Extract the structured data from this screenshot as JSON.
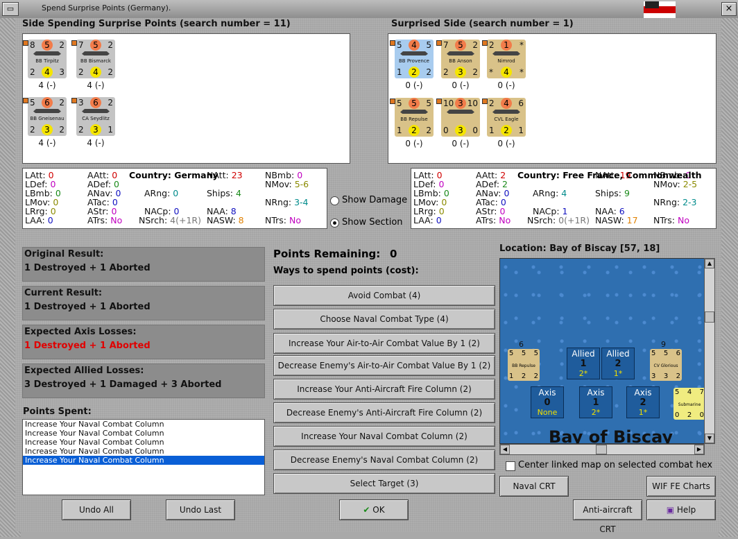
{
  "window": {
    "title": "Spend Surprise Points (Germany)."
  },
  "spending": {
    "header": "Side Spending Surprise Points (search number = 11)",
    "units": [
      {
        "tl": "8",
        "top": "5",
        "tr": "2",
        "name": "BB Tirpitz",
        "bl": "2",
        "bot": "4",
        "br": "3",
        "sub": "4 (-)",
        "color": "grey"
      },
      {
        "tl": "7",
        "top": "5",
        "tr": "2",
        "name": "BB Bismarck",
        "bl": "2",
        "bot": "4",
        "br": "2",
        "sub": "4 (-)",
        "color": "grey"
      },
      {
        "tl": "5",
        "top": "6",
        "tr": "2",
        "name": "BB Gneisenau",
        "bl": "2",
        "bot": "3",
        "br": "2",
        "sub": "4 (-)",
        "color": "grey"
      },
      {
        "tl": "3",
        "top": "6",
        "tr": "2",
        "name": "CA Seydlitz",
        "bl": "2",
        "bot": "3",
        "br": "1",
        "sub": "4 (-)",
        "color": "grey"
      }
    ]
  },
  "surprised": {
    "header": "Surprised Side (search number = 1)",
    "units": [
      {
        "tl": "5",
        "top": "4",
        "tr": "5",
        "name": "BB Provence",
        "bl": "1",
        "bot": "2",
        "br": "2",
        "sub": "0 (-)",
        "color": "blue"
      },
      {
        "tl": "7",
        "top": "5",
        "tr": "2",
        "name": "BB Anson",
        "bl": "2",
        "bot": "3",
        "br": "2",
        "sub": "0 (-)",
        "color": "tan"
      },
      {
        "tl": "2",
        "top": "1",
        "tr": "*",
        "name": "Nimrod",
        "bl": "*",
        "bot": "4",
        "br": "*",
        "sub": "0 (-)",
        "color": "tan"
      },
      {
        "tl": "5",
        "top": "5",
        "tr": "5",
        "name": "BB Repulse",
        "bl": "1",
        "bot": "2",
        "br": "2",
        "sub": "0 (-)",
        "color": "tan"
      },
      {
        "tl": "10",
        "top": "3",
        "tr": "10",
        "name": "",
        "bl": "0",
        "bot": "3",
        "br": "0",
        "sub": "0 (-)",
        "color": "tan"
      },
      {
        "tl": "2",
        "top": "4",
        "tr": "6",
        "name": "CVL Eagle",
        "bl": "1",
        "bot": "2",
        "br": "1",
        "sub": "0 (-)",
        "color": "tan"
      }
    ]
  },
  "stats_left": {
    "country_label": "Country:",
    "country": "Germany",
    "LAtt": "0",
    "LDef": "0",
    "LBmb": "0",
    "LMov": "0",
    "LRrg": "0",
    "LAA": "0",
    "AAtt": "0",
    "ADef": "0",
    "ANav": "0",
    "ATac": "0",
    "AStr": "0",
    "ATrs": "No",
    "ARng": "0",
    "NACp": "0",
    "NSrch": "4(+1R)",
    "NAtt": "23",
    "Ships": "4",
    "NAA": "8",
    "NASW": "8",
    "NBmb": "0",
    "NMov": "5-6",
    "NRng": "3-4",
    "NTrs": "No"
  },
  "stats_right": {
    "country_label": "Country:",
    "country": "Free France, Commonwealth",
    "LAtt": "0",
    "LDef": "0",
    "LBmb": "0",
    "LMov": "0",
    "LRrg": "0",
    "LAA": "0",
    "AAtt": "2",
    "ADef": "2",
    "ANav": "0",
    "ATac": "0",
    "AStr": "0",
    "ATrs": "No",
    "ARng": "4",
    "NACp": "1",
    "NSrch": "0(+1R)",
    "NAtt": "19",
    "Ships": "9",
    "NAA": "6",
    "NASW": "17",
    "NBmb": "0",
    "NMov": "2-5",
    "NRng": "2-3",
    "NTrs": "No"
  },
  "labels": {
    "LAtt": "LAtt:",
    "LDef": "LDef:",
    "LBmb": "LBmb:",
    "LMov": "LMov:",
    "LRrg": "LRrg:",
    "LAA": "LAA:",
    "AAtt": "AAtt:",
    "ADef": "ADef:",
    "ANav": "ANav:",
    "ATac": "ATac:",
    "AStr": "AStr:",
    "ATrs": "ATrs:",
    "ARng": "ARng:",
    "NACp": "NACp:",
    "NSrch": "NSrch:",
    "NAtt": "NAtt:",
    "Ships": "Ships:",
    "NAA": "NAA:",
    "NASW": "NASW:",
    "NBmb": "NBmb:",
    "NMov": "NMov:",
    "NRng": "NRng:",
    "NTrs": "NTrs:"
  },
  "view": {
    "show_damage": "Show Damage",
    "show_section": "Show Section",
    "selected": "show_section"
  },
  "results": {
    "original_title": "Original Result:",
    "original": "1 Destroyed + 1 Aborted",
    "current_title": "Current Result:",
    "current": "1 Destroyed + 1 Aborted",
    "axis_title": "Expected Axis Losses:",
    "axis": "1 Destroyed + 1 Aborted",
    "allied_title": "Expected Allied Losses:",
    "allied": "3 Destroyed + 1 Damaged + 3 Aborted"
  },
  "points_spent": {
    "title": "Points Spent:",
    "items": [
      "Increase Your Naval Combat Column",
      "Increase Your Naval Combat Column",
      "Increase Your Naval Combat Column",
      "Increase Your Naval Combat Column",
      "Increase Your Naval Combat Column"
    ],
    "selected_index": 4
  },
  "spend": {
    "remaining_label": "Points Remaining:",
    "remaining": "0",
    "ways_label": "Ways to spend points (cost):",
    "options": [
      "Avoid Combat (4)",
      "Choose Naval Combat Type (4)",
      "Increase Your Air-to-Air Combat Value By 1 (2)",
      "Decrease Enemy's Air-to-Air Combat Value By 1 (2)",
      "Increase Your Anti-Aircraft Fire Column (2)",
      "Decrease Enemy's Anti-Aircraft Fire Column (2)",
      "Increase Your Naval Combat Column (2)",
      "Decrease Enemy's Naval Combat Column (2)",
      "Select Target (3)"
    ]
  },
  "map": {
    "location": "Location: Bay of Biscay [57, 18]",
    "sea_label": "Bay of Biscay",
    "allied": [
      {
        "label": "Allied",
        "num": "1",
        "sub": "2*"
      },
      {
        "label": "Allied",
        "num": "2",
        "sub": "1*"
      }
    ],
    "axis": [
      {
        "label": "Axis",
        "num": "0",
        "sub": "None"
      },
      {
        "label": "Axis",
        "num": "1",
        "sub": "2*"
      },
      {
        "label": "Axis",
        "num": "2",
        "sub": "1*"
      }
    ],
    "stack1": {
      "count": "6",
      "name": "BB Repulse",
      "t1": "5",
      "t2": "5",
      "t3": "5",
      "b1": "1",
      "b2": "2",
      "b3": "2"
    },
    "stack2": {
      "count": "9",
      "name": "CV Glorious",
      "t1": "5",
      "t2": "5",
      "t3": "6",
      "b1": "3",
      "b2": "3",
      "b3": "2"
    },
    "stack3": {
      "count": "",
      "name": "Submarine",
      "t1": "5",
      "t2": "4",
      "t3": "7",
      "b1": "0",
      "b2": "2",
      "b3": "0"
    },
    "center_linked": "Center linked map on selected combat hex",
    "center_checked": false
  },
  "buttons": {
    "undo_all": "Undo All",
    "undo_last": "Undo Last",
    "ok": "OK",
    "naval_crt": "Naval CRT",
    "wif_charts": "WIF FE Charts",
    "aa_crt": "Anti-aircraft CRT",
    "help": "Help"
  }
}
